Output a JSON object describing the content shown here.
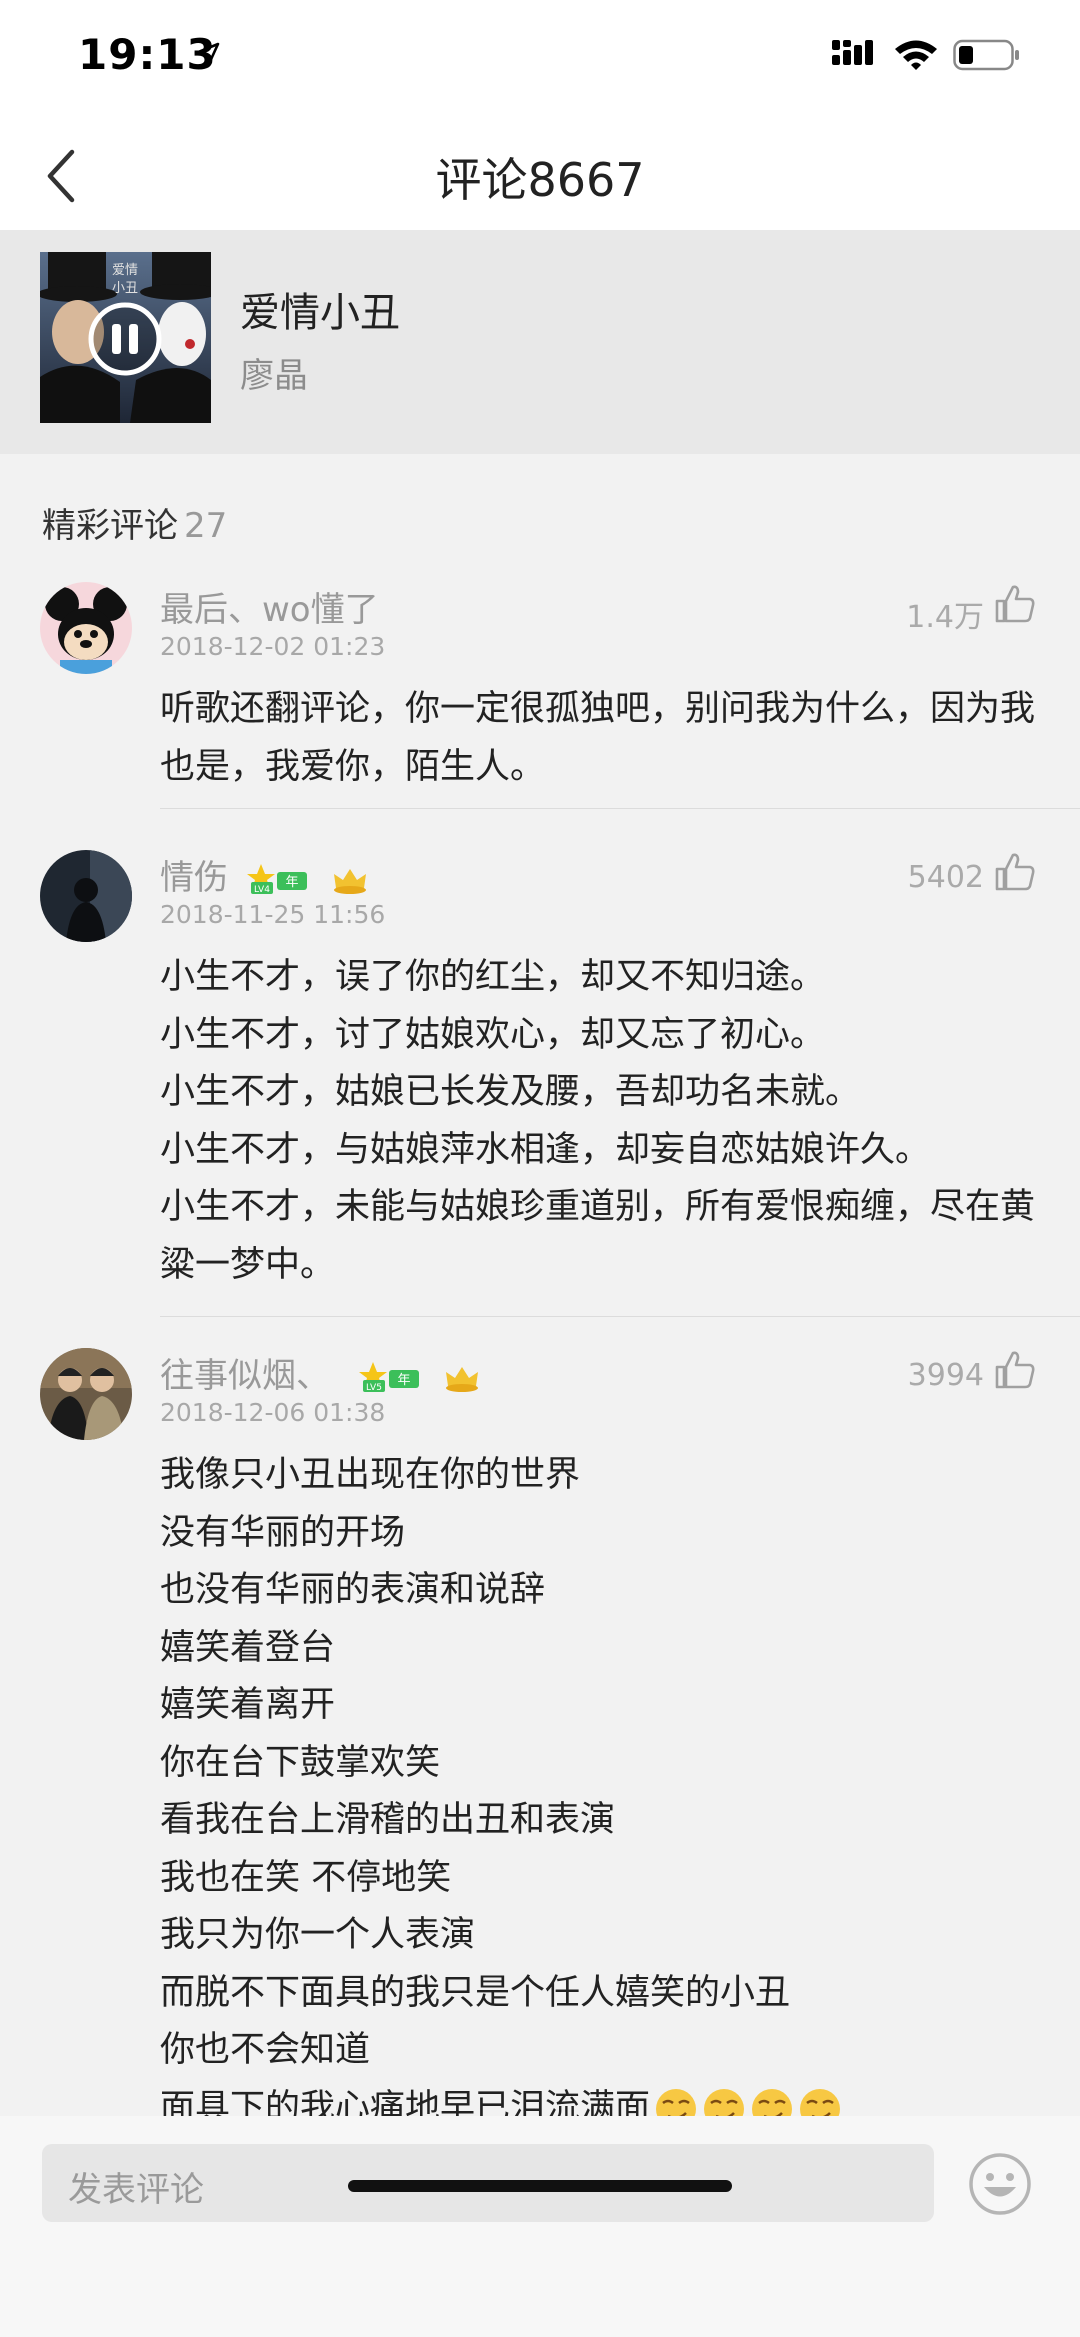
{
  "status_bar": {
    "time": "19:13",
    "icons": [
      "location-arrow-icon",
      "signal-icon",
      "wifi-icon",
      "battery-icon"
    ]
  },
  "nav": {
    "title": "评论8667",
    "back_icon": "chevron-left-icon"
  },
  "song": {
    "title": "爱情小丑",
    "artist": "廖晶",
    "cover_icon": "pause-icon",
    "cover_text": "爱情 小丑"
  },
  "section": {
    "label": "精彩评论",
    "count": "27"
  },
  "comments": [
    {
      "user": "最后、wo懂了",
      "date": "2018-12-02 01:23",
      "likes": "1.4万",
      "text": "听歌还翻评论，你一定很孤独吧，别问我为什么，因为我也是，我爱你，陌生人。"
    },
    {
      "user": "情伤",
      "badge_level": "LV4",
      "badge_year": "年",
      "date": "2018-11-25 11:56",
      "likes": "5402",
      "lines": [
        "小生不才，误了你的红尘，却又不知归途。",
        "小生不才，讨了姑娘欢心，却又忘了初心。",
        "小生不才，姑娘已长发及腰，吾却功名未就。",
        "小生不才，与姑娘萍水相逢，却妄自恋姑娘许久。",
        "小生不才，未能与姑娘珍重道别，所有爱恨痴缠，尽在黄粱一梦中。"
      ]
    },
    {
      "user": "往事似烟、",
      "badge_level": "LV5",
      "badge_year": "年",
      "date": "2018-12-06 01:38",
      "likes": "3994",
      "lines": [
        "我像只小丑出现在你的世界",
        "没有华丽的开场",
        "也没有华丽的表演和说辞",
        "嬉笑着登台",
        "嬉笑着离开",
        "你在台下鼓掌欢笑",
        "看我在台上滑稽的出丑和表演",
        "我也在笑 不停地笑",
        "我只为你一个人表演",
        "而脱不下面具的我只是个任人嬉笑的小丑",
        "你也不会知道",
        "面具下的我心痛地早已泪流满面"
      ],
      "emoji_count": 4
    }
  ],
  "composer": {
    "placeholder": "发表评论",
    "emoji_icon": "smile-face-icon"
  },
  "colors": {
    "background": "#f2f2f2",
    "header_band": "#e8e8e8",
    "secondary_text": "#999999",
    "badge_green": "#3cbf5a",
    "crown_gold": "#f2c230"
  }
}
